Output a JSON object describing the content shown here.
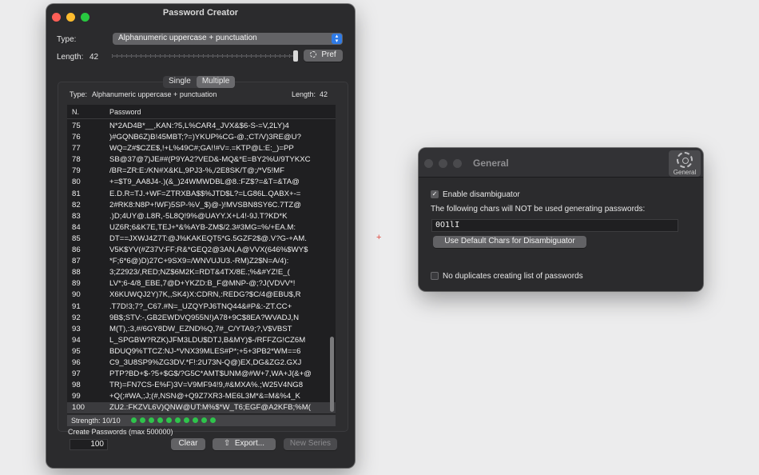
{
  "colors": {
    "close": "#ff5f57",
    "minimize": "#febc2e",
    "zoom": "#28c840",
    "inactive_dot": "#4a4a4d",
    "strength_led": "#2ec44b",
    "accent": "#2f7be6"
  },
  "creator": {
    "title": "Password Creator",
    "type_label": "Type:",
    "type_value": "Alphanumeric uppercase + punctuation",
    "length_label": "Length:",
    "length_value": "42",
    "slider_value": 42,
    "pref_button": "Pref",
    "tabs": [
      {
        "label": "Single",
        "selected": false
      },
      {
        "label": "Multiple",
        "selected": true
      }
    ],
    "info_type_label": "Type:",
    "info_type_value": "Alphanumeric uppercase + punctuation",
    "info_length_label": "Length:",
    "info_length_value": "42",
    "table": {
      "headers": [
        "N.",
        "Password"
      ],
      "rows": [
        {
          "n": "75",
          "pw": "N*2AD4B*__,KAN:?5,L%CAR4_JVX&$6-S-=V,2LY)4"
        },
        {
          "n": "76",
          "pw": ")#GQNB6Z)B!45MBT;?=)YKUP%CG-@.;CT/V)3RE@U?"
        },
        {
          "n": "77",
          "pw": "WQ=Z#$CZE$,!+L%49C#;GA!!#V=.=KTP@L:E:_)=PP"
        },
        {
          "n": "78",
          "pw": "SB@37@7)JE##(P9YA2?VED&-MQ&*E=BY2%U/9TYKXC"
        },
        {
          "n": "79",
          "pw": "/BR=ZR:E:/KN#X&KL,9PJ3-%,/2E8SK/T@;/*V5!MF"
        },
        {
          "n": "80",
          "pw": "+=$T9_AA8J4-.)(&_)24WMWDBL@8.:FZ$?=&T=&TA@"
        },
        {
          "n": "81",
          "pw": "E.D.R=TJ.+WF=ZTRXBA$$%JTD$L?=LG86L.QABX+-="
        },
        {
          "n": "82",
          "pw": "2#RK8:N8P+!WF)5SP-%V_$)@-)!MVSBN8SY6C.7TZ@"
        },
        {
          "n": "83",
          "pw": ".)D;4UY@.L8R,-5L8Q!9%@UAYY.X+L4!-9J.T?KD*K"
        },
        {
          "n": "84",
          "pw": "UZ6R;6&K7E,TEJ+*&%AYB-ZM$/2.3#3MG=%/+EA.M:"
        },
        {
          "n": "85",
          "pw": "DT==JXWJ4Z7T:@J%KAKEQT5*G.5GZF2$@.V?G-+AM."
        },
        {
          "n": "86",
          "pw": "V5K$YV(#Z37V:FF;R&*GEQ2@3AN,A@VVX(646%$WY$"
        },
        {
          "n": "87",
          "pw": "*F;6*6@)D)27C+9SX9=/WNVUJU3.-RM)Z2$N=A/4):"
        },
        {
          "n": "88",
          "pw": "3;Z2923/,RED;NZ$6M2K=RDT&4TX/8E.;%&#YZ!E_("
        },
        {
          "n": "89",
          "pw": "LV*;6-4/8_EBE,7@D+YKZD:B_F@MNP-@;?J(VDVV*!"
        },
        {
          "n": "90",
          "pw": "X6KUWQJ2Y)7K,,SK4)X:CDRN,:REDG?$C/4@EBU$,R"
        },
        {
          "n": "91",
          "pw": ".T7D!3;7?_C67.#N=_UZQYPJ6TNQ44&#P&:-ZT.CC+"
        },
        {
          "n": "92",
          "pw": "9B$;STV:-,GB2EWDVQ955N!)A78+9C$8EA?WVADJ,N"
        },
        {
          "n": "93",
          "pw": "M(T),:3,#/6GY8DW_EZND%Q,7#_C/YTA9;?,V$VBST"
        },
        {
          "n": "94",
          "pw": "L_SPGBW?RZK)JFM3LDU$DTJ,B&MY)$-/RFFZG!CZ6M"
        },
        {
          "n": "95",
          "pw": "BDUQ9%TTCZ:NJ-*VNX39MLES#P*;+5+3PB2*WM==6"
        },
        {
          "n": "96",
          "pw": "C9_3U8SP9%ZG3DV.*F!:2U73N-Q@)EX,DG&ZG2.GXJ"
        },
        {
          "n": "97",
          "pw": "PTP?BD+$-?5+$G$/?G5C*AMT$UNM@#W+7,WA+J(&+@"
        },
        {
          "n": "98",
          "pw": "TR)=FN7CS-E%F)3V=V9MF94!9,#&MXA%.;W25V4NG8"
        },
        {
          "n": "99",
          "pw": "+Q(;#WA,;J;(#,NSN@+Q9Z7XR3-ME6L3M*&=M&%4_K"
        },
        {
          "n": "100",
          "pw": "ZU2.:FKZVL6V)QNW@UT:M%$*W_T6;EGF@A2KFB;%M("
        }
      ]
    },
    "strength_label": "Strength:",
    "strength_value": "10/10",
    "strength_level": 10,
    "create_label": "Create Passwords (max 500000)",
    "count_value": "100",
    "clear_button": "Clear",
    "export_button": "Export...",
    "new_series_button": "New Series"
  },
  "general": {
    "title": "General",
    "toolbar_label": "General",
    "enable_label": "Enable disambiguator",
    "enable_checked": true,
    "chars_desc": "The following chars will NOT be used generating passwords:",
    "chars_value": "0O1lI",
    "default_button": "Use Default Chars for Disambiguator",
    "nodup_label": "No duplicates creating list of passwords",
    "nodup_checked": false
  },
  "cursor_glyph": "+"
}
